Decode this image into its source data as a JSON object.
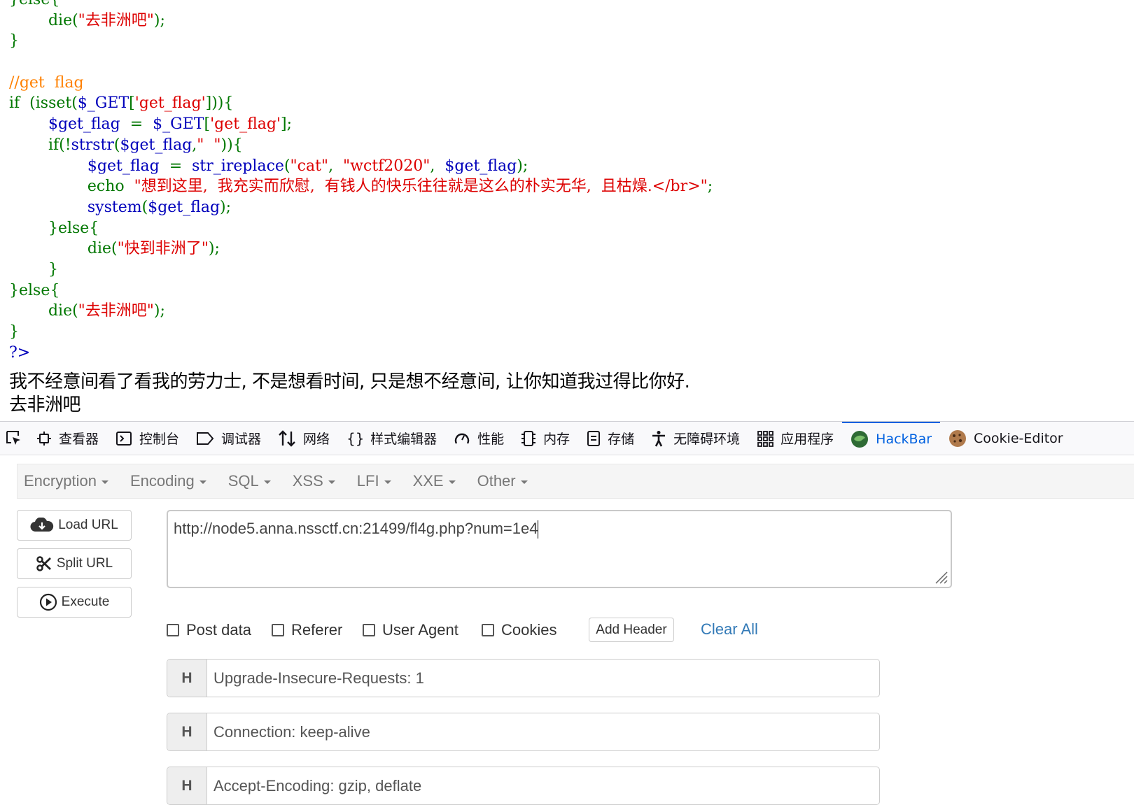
{
  "source": {
    "lines": [
      {
        "p": [
          {
            "c": "k",
            "t": "}else{"
          }
        ]
      },
      {
        "p": [
          {
            "c": "k",
            "t": "        die("
          },
          {
            "c": "s",
            "t": "\"去非洲吧\""
          },
          {
            "c": "k",
            "t": ");"
          }
        ]
      },
      {
        "p": [
          {
            "c": "k",
            "t": "}"
          }
        ]
      },
      {
        "p": []
      },
      {
        "p": [
          {
            "c": "c",
            "t": "//get  flag"
          }
        ]
      },
      {
        "p": [
          {
            "c": "k",
            "t": "if  (isset("
          },
          {
            "c": "v",
            "t": "$_GET"
          },
          {
            "c": "k",
            "t": "["
          },
          {
            "c": "s",
            "t": "'get_flag'"
          },
          {
            "c": "k",
            "t": "])){"
          }
        ]
      },
      {
        "p": [
          {
            "c": "v",
            "t": "        $get_flag  "
          },
          {
            "c": "k",
            "t": "= "
          },
          {
            "c": "v",
            "t": " $_GET"
          },
          {
            "c": "k",
            "t": "["
          },
          {
            "c": "s",
            "t": "'get_flag'"
          },
          {
            "c": "k",
            "t": "];"
          }
        ]
      },
      {
        "p": [
          {
            "c": "k",
            "t": "        if(!"
          },
          {
            "c": "v",
            "t": "strstr"
          },
          {
            "c": "k",
            "t": "("
          },
          {
            "c": "v",
            "t": "$get_flag"
          },
          {
            "c": "k",
            "t": ","
          },
          {
            "c": "s",
            "t": "\"  \""
          },
          {
            "c": "k",
            "t": ")){"
          }
        ]
      },
      {
        "p": [
          {
            "c": "v",
            "t": "                $get_flag  "
          },
          {
            "c": "k",
            "t": "= "
          },
          {
            "c": "v",
            "t": " str_ireplace"
          },
          {
            "c": "k",
            "t": "("
          },
          {
            "c": "s",
            "t": "\"cat\""
          },
          {
            "c": "k",
            "t": ",  "
          },
          {
            "c": "s",
            "t": "\"wctf2020\""
          },
          {
            "c": "k",
            "t": ",  "
          },
          {
            "c": "v",
            "t": "$get_flag"
          },
          {
            "c": "k",
            "t": ");"
          }
        ]
      },
      {
        "p": [
          {
            "c": "k",
            "t": "                echo  "
          },
          {
            "c": "s",
            "t": "\"想到这里,  我充实而欣慰,  有钱人的快乐往往就是这么的朴实无华,  且枯燥.</br>\""
          },
          {
            "c": "k",
            "t": ";"
          }
        ]
      },
      {
        "p": [
          {
            "c": "v",
            "t": "                system"
          },
          {
            "c": "k",
            "t": "("
          },
          {
            "c": "v",
            "t": "$get_flag"
          },
          {
            "c": "k",
            "t": ");"
          }
        ]
      },
      {
        "p": [
          {
            "c": "k",
            "t": "        }else{"
          }
        ]
      },
      {
        "p": [
          {
            "c": "k",
            "t": "                die("
          },
          {
            "c": "s",
            "t": "\"快到非洲了\""
          },
          {
            "c": "k",
            "t": ");"
          }
        ]
      },
      {
        "p": [
          {
            "c": "k",
            "t": "        }"
          }
        ]
      },
      {
        "p": [
          {
            "c": "k",
            "t": "}else{"
          }
        ]
      },
      {
        "p": [
          {
            "c": "k",
            "t": "        die("
          },
          {
            "c": "s",
            "t": "\"去非洲吧\""
          },
          {
            "c": "k",
            "t": ");"
          }
        ]
      },
      {
        "p": [
          {
            "c": "k",
            "t": "}"
          }
        ]
      },
      {
        "p": [
          {
            "c": "v",
            "t": "?>"
          }
        ]
      }
    ],
    "output_line1": "我不经意间看了看我的劳力士, 不是想看时间, 只是想不经意间, 让你知道我过得比你好.",
    "output_line2": "去非洲吧"
  },
  "devtools": {
    "tabs": [
      {
        "label": "查看器",
        "icon": "inspector-icon"
      },
      {
        "label": "控制台",
        "icon": "console-icon"
      },
      {
        "label": "调试器",
        "icon": "debugger-icon"
      },
      {
        "label": "网络",
        "icon": "network-icon"
      },
      {
        "label": "样式编辑器",
        "icon": "style-editor-icon"
      },
      {
        "label": "性能",
        "icon": "performance-icon"
      },
      {
        "label": "内存",
        "icon": "memory-icon"
      },
      {
        "label": "存储",
        "icon": "storage-icon"
      },
      {
        "label": "无障碍环境",
        "icon": "accessibility-icon"
      },
      {
        "label": "应用程序",
        "icon": "application-icon"
      },
      {
        "label": "HackBar",
        "icon": "hackbar-icon",
        "active": true
      },
      {
        "label": "Cookie-Editor",
        "icon": "cookie-icon"
      }
    ],
    "active_color": "#0061e0"
  },
  "hackbar": {
    "menus": [
      "Encryption",
      "Encoding",
      "SQL",
      "XSS",
      "LFI",
      "XXE",
      "Other"
    ],
    "load_url": "Load URL",
    "split_url": "Split URL",
    "execute": "Execute",
    "url_value": "http://node5.anna.nssctf.cn:21499/fl4g.php?num=1e4",
    "options": [
      "Post data",
      "Referer",
      "User Agent",
      "Cookies"
    ],
    "add_header": "Add Header",
    "clear_all": "Clear All",
    "headers": [
      {
        "tag": "H",
        "value": "Upgrade-Insecure-Requests: 1"
      },
      {
        "tag": "H",
        "value": "Connection: keep-alive"
      },
      {
        "tag": "H",
        "value": "Accept-Encoding: gzip, deflate"
      }
    ]
  }
}
